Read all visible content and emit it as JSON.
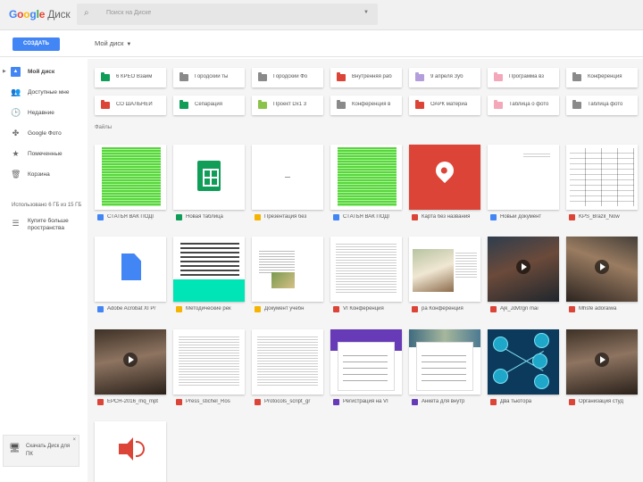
{
  "header": {
    "logo_letters": [
      "G",
      "o",
      "o",
      "g",
      "l",
      "e"
    ],
    "product": "Диск",
    "search_placeholder": "Поиск на Диске"
  },
  "toolbar": {
    "create_label": "СОЗДАТЬ",
    "breadcrumb": "Мой диск"
  },
  "sidebar": {
    "items": [
      {
        "label": "Мой диск",
        "icon": "drive-icon",
        "glyph": "▲"
      },
      {
        "label": "Доступные мне",
        "icon": "people-icon",
        "glyph": "👥"
      },
      {
        "label": "Недавние",
        "icon": "clock-icon",
        "glyph": "🕒"
      },
      {
        "label": "Google Фото",
        "icon": "pinwheel-icon",
        "glyph": "✤"
      },
      {
        "label": "Помеченные",
        "icon": "star-icon",
        "glyph": "★"
      },
      {
        "label": "Корзина",
        "icon": "trash-icon",
        "glyph": "🗑"
      }
    ],
    "storage": "Использовано 6 ГБ из 15 ГБ",
    "upgrade_line1": "Купите больше",
    "upgrade_line2": "пространства",
    "notice_line1": "Скачать Диск для",
    "notice_line2": "ПК",
    "close_glyph": "×"
  },
  "colors": {
    "accent": "#4285f4",
    "folder_grey": "#8a8a8a",
    "folder_red": "#db4437",
    "folder_green": "#0f9d58",
    "folder_lightgreen": "#8bc34a",
    "folder_lilac": "#b39ddb",
    "folder_pink": "#f4a7b9"
  },
  "folders": [
    {
      "name": "6 КРЕО Взаим",
      "color": "#0f9d58"
    },
    {
      "name": "Городский ты",
      "color": "#8a8a8a"
    },
    {
      "name": "Городский Фо",
      "color": "#8a8a8a"
    },
    {
      "name": "Внутренняя раб",
      "color": "#db4437"
    },
    {
      "name": "9 апреля Зуб",
      "color": "#b39ddb"
    },
    {
      "name": "Программа вз",
      "color": "#f4a7b9"
    },
    {
      "name": "Конференция",
      "color": "#8a8a8a"
    },
    {
      "name": "СО ШАЛЬНЕЙ",
      "color": "#db4437"
    },
    {
      "name": "Сепарация",
      "color": "#0f9d58"
    },
    {
      "name": "Проект Dx1 3",
      "color": "#8bc34a"
    },
    {
      "name": "Конференция в",
      "color": "#8a8a8a"
    },
    {
      "name": "ОАРК материа",
      "color": "#db4437"
    },
    {
      "name": "Таблица о фото",
      "color": "#f4a7b9"
    },
    {
      "name": "Таблица фото",
      "color": "#8a8a8a"
    }
  ],
  "files_label": "Файлы",
  "files": [
    {
      "name": "СТАТЬЯ ВАК ПОДГ",
      "thumb": "green",
      "icon_color": "#4285f4",
      "icon": "word-icon"
    },
    {
      "name": "Новая таблица",
      "thumb": "sheet",
      "icon_color": "#0f9d58",
      "icon": "sheet-icon"
    },
    {
      "name": "Презентация без",
      "thumb": "blank",
      "icon_color": "#f4b400",
      "icon": "slides-icon"
    },
    {
      "name": "СТАТЬЯ ВАК ПОДГ",
      "thumb": "green",
      "icon_color": "#4285f4",
      "icon": "word-icon"
    },
    {
      "name": "Карта без названия",
      "thumb": "map",
      "icon_color": "#db4437",
      "icon": "map-icon"
    },
    {
      "name": "Новый документ",
      "thumb": "smalldoc",
      "icon_color": "#4285f4",
      "icon": "doc-icon"
    },
    {
      "name": "KPS_Brazil_Now",
      "thumb": "table",
      "icon_color": "#db4437",
      "icon": "pdf-icon"
    },
    {
      "name": "Adobe Acrobat XI Pr",
      "thumb": "bluedoc",
      "icon_color": "#4285f4",
      "icon": "file-icon"
    },
    {
      "name": "Методические рек",
      "thumb": "teal",
      "icon_color": "#f4b400",
      "icon": "slides-icon"
    },
    {
      "name": "Документ учебн",
      "thumb": "form",
      "icon_color": "#f4b400",
      "icon": "slides-icon"
    },
    {
      "name": "VI Конференция",
      "thumb": "doc",
      "icon_color": "#db4437",
      "icon": "pdf-icon"
    },
    {
      "name": "pa Конференция",
      "thumb": "frame",
      "icon_color": "#db4437",
      "icon": "pdf-icon"
    },
    {
      "name": "Ajk_Jdvtrgn mai",
      "thumb": "video",
      "icon_color": "#db4437",
      "icon": "video-icon"
    },
    {
      "name": "Mhsfe adoraiwa",
      "thumb": "video2",
      "icon_color": "#db4437",
      "icon": "video-icon"
    },
    {
      "name": "ЕРСН-2016_mq_mpt",
      "thumb": "video3",
      "icon_color": "#db4437",
      "icon": "video-icon"
    },
    {
      "name": "Press_stichel_Ros",
      "thumb": "doc",
      "icon_color": "#db4437",
      "icon": "pdf-icon"
    },
    {
      "name": "Protocols_script_gr",
      "thumb": "doc",
      "icon_color": "#db4437",
      "icon": "pdf-icon"
    },
    {
      "name": "Регистрация на VI",
      "thumb": "purpleform",
      "icon_color": "#673ab7",
      "icon": "form-icon"
    },
    {
      "name": "Анкета для внутр",
      "thumb": "photoform",
      "icon_color": "#673ab7",
      "icon": "form-icon"
    },
    {
      "name": "Два тьютора",
      "thumb": "net",
      "icon_color": "#db4437",
      "icon": "pdf-icon"
    },
    {
      "name": "Организация студ",
      "thumb": "video3",
      "icon_color": "#db4437",
      "icon": "video-icon"
    },
    {
      "name": "",
      "thumb": "speaker",
      "icon_color": "#db4437",
      "icon": "audio-icon"
    }
  ]
}
